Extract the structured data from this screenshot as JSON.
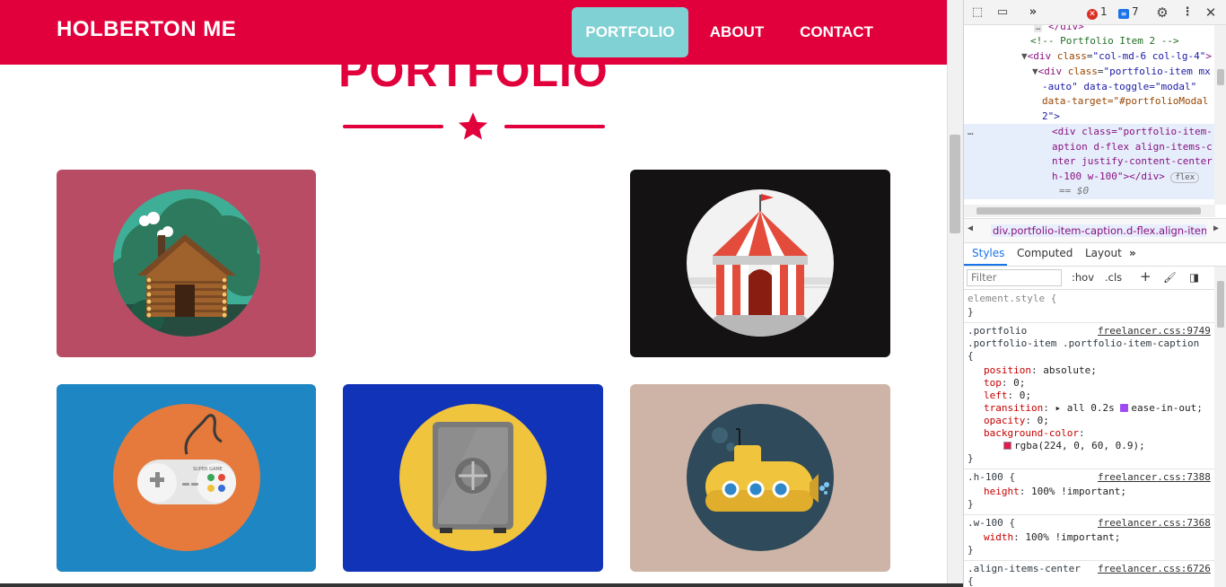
{
  "site": {
    "brand": "HOLBERTON ME",
    "nav": [
      {
        "label": "PORTFOLIO",
        "active": true
      },
      {
        "label": "ABOUT"
      },
      {
        "label": "CONTACT"
      }
    ],
    "heading": "PORTFOLIO",
    "colors": {
      "primary": "#e1003c",
      "active_nav": "#7fd1d4"
    },
    "portfolio_items": [
      {
        "icon": "log-cabin-icon",
        "bg": "#b84c64"
      },
      {
        "icon": "circus-tent-icon",
        "bg": "#141212"
      },
      {
        "icon": "game-controller-icon",
        "bg": "#1e86c3",
        "controller_text": "SUPER GAME"
      },
      {
        "icon": "safe-icon",
        "bg": "#1133b8"
      },
      {
        "icon": "submarine-icon",
        "bg": "#cdb4a7"
      }
    ]
  },
  "devtools": {
    "toolbar": {
      "more": "»",
      "errors": "1",
      "messages": "7"
    },
    "elements": {
      "l1": "</div>",
      "l2": "<!-- Portfolio Item 2 -->",
      "l3_tag": "<div",
      "l3_attr": "class",
      "l3_val": "\"col-md-6 col-lg-4\"",
      "l4_tag": "<div",
      "l4_attr": "class",
      "l4_val": "\"portfolio-item mx",
      "l5": "-auto\" data-toggle=\"modal\"",
      "l6": "data-target=\"#portfolioModal",
      "l7": "2\">",
      "l8": "<div class=\"portfolio-item-",
      "l9": "aption d-flex align-items-c",
      "l10": "nter justify-content-center",
      "l11": "h-100 w-100\"></div>",
      "flex_badge": "flex",
      "l12": "== $0"
    },
    "breadcrumb": "div.portfolio-item-caption.d-flex.align-items-c",
    "tabs": [
      {
        "label": "Styles"
      },
      {
        "label": "Computed"
      },
      {
        "label": "Layout"
      }
    ],
    "tabs_more": "»",
    "filter": {
      "placeholder": "Filter",
      "hov": ":hov",
      "cls": ".cls",
      "plus": "+"
    },
    "styles": {
      "element_style": "element.style {",
      "close": "}",
      "rule1_sel1": ".portfolio",
      "rule1_src": "freelancer.css:9749",
      "rule1_sel2": ".portfolio-item .portfolio-item-caption",
      "open": "{",
      "props1": [
        {
          "name": "position",
          "value": "absolute;"
        },
        {
          "name": "top",
          "value": "0;"
        },
        {
          "name": "left",
          "value": "0;"
        },
        {
          "name": "transition",
          "value": "▸ all 0.2s"
        },
        {
          "name": "opacity",
          "value": "0;"
        },
        {
          "name": "background-color",
          "value": ""
        }
      ],
      "ease": "ease-in-out;",
      "bg_value": "rgba(224, 0, 60, 0.9);",
      "rule2_sel": ".h-100 {",
      "rule2_src": "freelancer.css:7388",
      "rule2_prop": "height",
      "rule2_val": "100% !important;",
      "rule3_sel": ".w-100 {",
      "rule3_src": "freelancer.css:7368",
      "rule3_prop": "width",
      "rule3_val": "100% !important;",
      "rule4_sel": ".align-items-center",
      "rule4_src": "freelancer.css:6726"
    }
  }
}
